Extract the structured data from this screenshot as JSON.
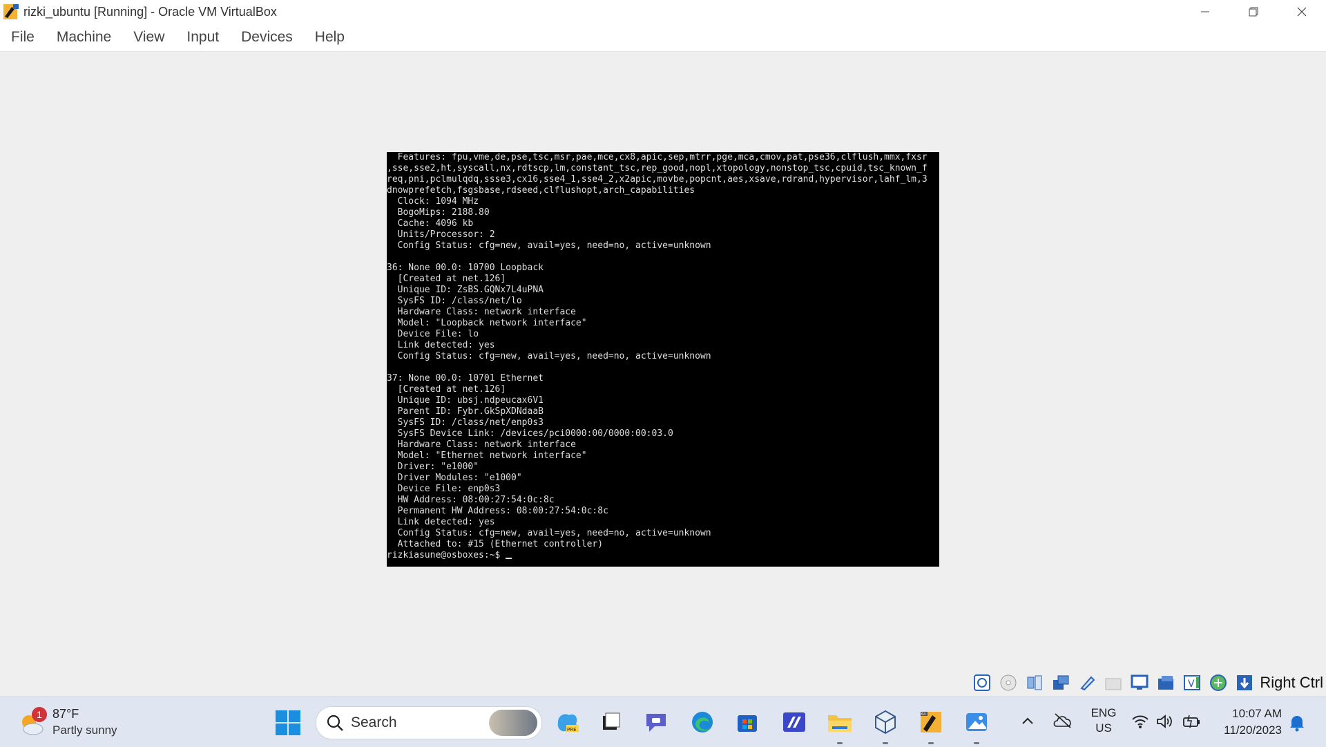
{
  "window": {
    "title": "rizki_ubuntu [Running] - Oracle VM VirtualBox"
  },
  "menu": [
    "File",
    "Machine",
    "View",
    "Input",
    "Devices",
    "Help"
  ],
  "console": {
    "lines": [
      "  Features: fpu,vme,de,pse,tsc,msr,pae,mce,cx8,apic,sep,mtrr,pge,mca,cmov,pat,pse36,clflush,mmx,fxsr",
      ",sse,sse2,ht,syscall,nx,rdtscp,lm,constant_tsc,rep_good,nopl,xtopology,nonstop_tsc,cpuid,tsc_known_f",
      "req,pni,pclmulqdq,ssse3,cx16,sse4_1,sse4_2,x2apic,movbe,popcnt,aes,xsave,rdrand,hypervisor,lahf_lm,3",
      "dnowprefetch,fsgsbase,rdseed,clflushopt,arch_capabilities",
      "  Clock: 1094 MHz",
      "  BogoMips: 2188.80",
      "  Cache: 4096 kb",
      "  Units/Processor: 2",
      "  Config Status: cfg=new, avail=yes, need=no, active=unknown",
      "",
      "36: None 00.0: 10700 Loopback",
      "  [Created at net.126]",
      "  Unique ID: ZsBS.GQNx7L4uPNA",
      "  SysFS ID: /class/net/lo",
      "  Hardware Class: network interface",
      "  Model: \"Loopback network interface\"",
      "  Device File: lo",
      "  Link detected: yes",
      "  Config Status: cfg=new, avail=yes, need=no, active=unknown",
      "",
      "37: None 00.0: 10701 Ethernet",
      "  [Created at net.126]",
      "  Unique ID: ubsj.ndpeucax6V1",
      "  Parent ID: Fybr.GkSpXDNdaaB",
      "  SysFS ID: /class/net/enp0s3",
      "  SysFS Device Link: /devices/pci0000:00/0000:00:03.0",
      "  Hardware Class: network interface",
      "  Model: \"Ethernet network interface\"",
      "  Driver: \"e1000\"",
      "  Driver Modules: \"e1000\"",
      "  Device File: enp0s3",
      "  HW Address: 08:00:27:54:0c:8c",
      "  Permanent HW Address: 08:00:27:54:0c:8c",
      "  Link detected: yes",
      "  Config Status: cfg=new, avail=yes, need=no, active=unknown",
      "  Attached to: #15 (Ethernet controller)"
    ],
    "prompt": "rizkiasune@osboxes:~$ "
  },
  "statusbar": {
    "icons": [
      "hard-disk-icon",
      "optical-drive-icon",
      "audio-icon",
      "network-icon",
      "usb-icon",
      "shared-folders-icon",
      "display-icon",
      "recording-icon",
      "virtualization-icon",
      "guest-additions-icon",
      "mouse-integration-icon"
    ],
    "host_key": "Right Ctrl"
  },
  "taskbar": {
    "weather": {
      "badge": "1",
      "temp": "87°F",
      "condition": "Partly sunny"
    },
    "search_label": "Search",
    "apps": [
      "copilot-icon",
      "task-view-icon",
      "teams-icon",
      "edge-icon",
      "store-icon",
      "vscode-like-icon",
      "file-explorer-icon",
      "virtualbox-manager-icon",
      "virtualbox-vm-icon",
      "photos-icon"
    ],
    "lang": {
      "line1": "ENG",
      "line2": "US"
    },
    "clock": {
      "time": "10:07 AM",
      "date": "11/20/2023"
    }
  }
}
